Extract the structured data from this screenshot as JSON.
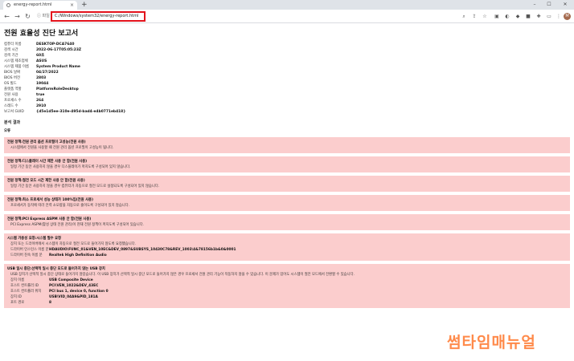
{
  "browser": {
    "tab_title": "energy-report.html",
    "tab_close": "×",
    "new_tab": "+",
    "window": {
      "minimize": "–",
      "maximize": "☐",
      "close": "✕"
    },
    "nav": {
      "back": "←",
      "forward": "→",
      "reload": "↻"
    },
    "lock_label": "ⓘ 파일",
    "url": "C:/Windows/system32/energy-report.html",
    "avatar_letter": "M"
  },
  "report": {
    "title": "전원 효율성 진단 보고서",
    "info": [
      {
        "label": "컴퓨터 이름",
        "value": "DESKTOP-DCA7640"
      },
      {
        "label": "검색 시간",
        "value": "2022-06-17T05:05:23Z"
      },
      {
        "label": "검색 기간",
        "value": "60초"
      },
      {
        "label": "시스템 제조업체",
        "value": "ASUS"
      },
      {
        "label": "시스템 제품 이름",
        "value": "System Product Name"
      },
      {
        "label": "BIOS 날짜",
        "value": "04/27/2022"
      },
      {
        "label": "BIOS 버전",
        "value": "2803"
      },
      {
        "label": "OS 빌드",
        "value": "19044"
      },
      {
        "label": "플랫폼 역할",
        "value": "PlatformRoleDesktop"
      },
      {
        "label": "전원 사용",
        "value": "true"
      },
      {
        "label": "프로세스 수",
        "value": "264"
      },
      {
        "label": "스레드 수",
        "value": "2910"
      },
      {
        "label": "보고서 GUID",
        "value": "{d5e1d5ee-310e-495d-bad4-e4b0771eb418}"
      }
    ],
    "analysis_heading": "분석 결과",
    "error_heading": "오류",
    "errors": [
      {
        "title": "전원 정책:전원 관리 옵션 프로필이 고성능(전원 사용)",
        "desc": "시스템에서 전원을 사용할 때 전원 관리 옵션 프로필이 고성능이 됩니다."
      },
      {
        "title": "전원 정책:디스플레이 시간 제한 사용 안 함(전원 사용)",
        "desc": "일정 기간 동안 사용하지 않을 경우 디스플레이가 꺼지도록 구성되어 있지 않습니다."
      },
      {
        "title": "전원 정책:절전 모드 시간 제한 사용 안 함(전원 사용)",
        "desc": "일정 기간 동안 사용하지 않을 경우 컴퓨터가 자동으로 절전 모드로 설정되도록 구성되어 있지 않습니다."
      },
      {
        "title": "전원 정책:최소 프로세서 성능 상태가 100%임(전원 사용)",
        "desc": "프로세서가 동작에 따라 전력 소모량을 자동으로 줄이도록 구성되어 있지 않습니다."
      },
      {
        "title": "전원 정책:PCI Express ASPM 사용 안 함(전원 사용)",
        "desc": "PCI Express ASPM(활성 상태 전원 관리)이 현재 전원 정책이 꺼지도록 구성되어 있습니다."
      }
    ],
    "usb_audio": {
      "title": "시스템 가용성 요청:시스템 필수 요청",
      "desc": "장치 또는 드라이버에서 시스템이 자동으로 절전 모드로 들어가지 않도록 요청했습니다.",
      "rows": [
        {
          "key": "드라이버 인스턴스 이름 문",
          "value": "HDAUDIO\\FUNC_01&VEN_10EC&DEV_0897&SUBSYS_10430C78&REV_1003\\4&78156b1b&0&0001"
        },
        {
          "key": "드라이버 친숙 이름 문",
          "value": "Realtek High Definition Audio"
        }
      ]
    },
    "usb_suspend": {
      "title": "USB 일시 중단:선택적 일시 중단 모드로 들어가지 않는 USB 장치",
      "desc": "USB 장치가 선택적 일시 중단 상태로 들어가지 않았습니다. 이 USB 장치가 선택적 일시 중단 모드로 들어가지 않은 경우 프로세서 전원 관리 기능이 작동하지 않을 수 있습니다. 이 문제가 있어도 시스템이 절전 모드에서 전환할 수 있습니다.",
      "rows": [
        {
          "key": "장치 이름",
          "value": "USB Composite Device"
        },
        {
          "key": "호스트 컨트롤러 ID",
          "value": "PCI\\VEN_1022&DEV_43EC"
        },
        {
          "key": "호스트 컨트롤러 위치",
          "value": "PCI bus 1, device 0, function 0"
        },
        {
          "key": "장치 ID",
          "value": "USB\\VID_04A9&PID_181A"
        },
        {
          "key": "포트 경로",
          "value": "8"
        }
      ]
    }
  },
  "watermark": "썸타임매뉴얼",
  "colors": {
    "error_bg": "#fbcdcd",
    "url_highlight": "#e3131c",
    "watermark": "#ff8a4a"
  }
}
